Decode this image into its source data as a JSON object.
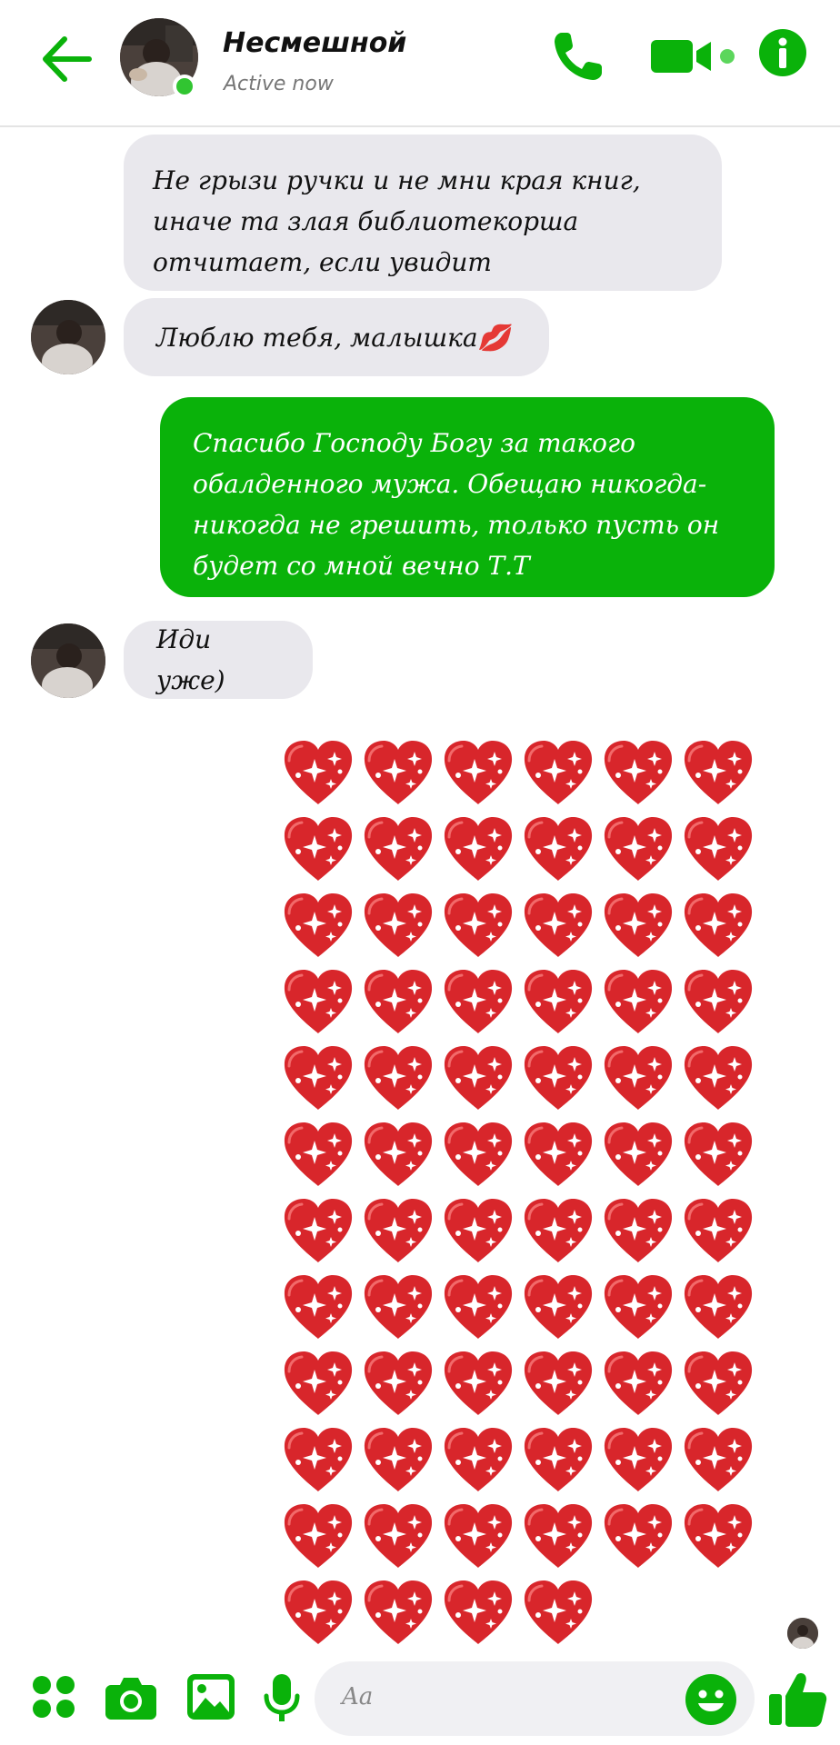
{
  "header": {
    "contact_name": "Несмешной",
    "status": "Active now"
  },
  "messages": [
    {
      "direction": "incoming",
      "text": "Не грызи ручки и не мни края книг, иначе та злая библиотекорша отчитает, если увидит"
    },
    {
      "direction": "incoming",
      "text": "Люблю тебя, малышка💋"
    },
    {
      "direction": "outgoing",
      "text": "Спасибо Господу Богу за такого обалденного мужа. Обещаю никогда-никогда не грешить, только пусть он будет со мной вечно Т.Т"
    },
    {
      "direction": "incoming",
      "text": "Иди уже)"
    },
    {
      "direction": "outgoing",
      "type": "emoji",
      "emoji": "sparkling-heart",
      "count": 70
    }
  ],
  "composer": {
    "placeholder": "Aa"
  },
  "colors": {
    "accent": "#0ab20a",
    "incoming_bubble": "#e9e8ed",
    "heart": "#d8262b"
  },
  "icons": [
    "back-arrow-icon",
    "phone-icon",
    "video-camera-icon",
    "info-icon",
    "apps-icon",
    "camera-icon",
    "gallery-icon",
    "microphone-icon",
    "emoji-icon",
    "thumbs-up-icon"
  ]
}
